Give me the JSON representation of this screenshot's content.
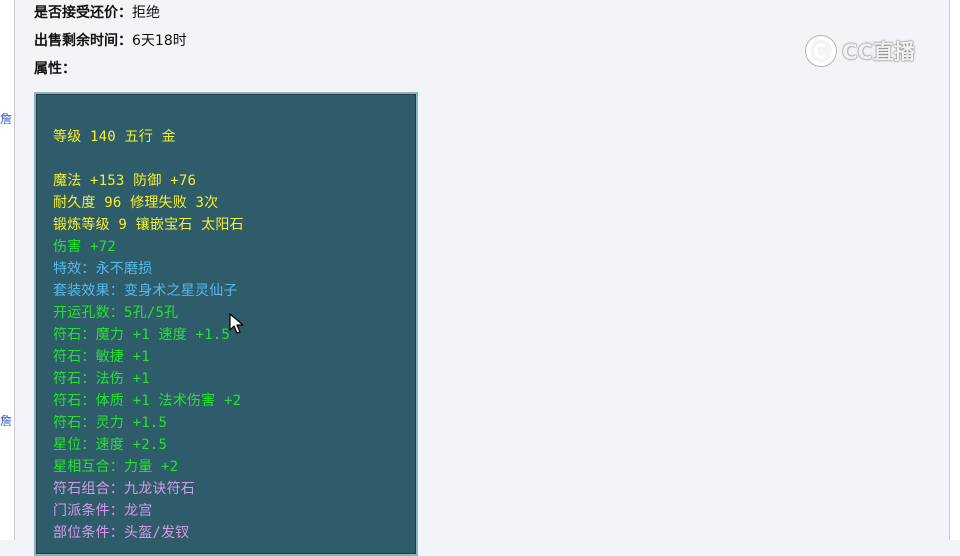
{
  "header": {
    "counter_offer_label": "是否接受还价：",
    "counter_offer_value": "拒绝",
    "time_left_label": "出售剩余时间：",
    "time_left_value": "6天18时",
    "attributes_label": "属性："
  },
  "edge_marks": [
    "詹",
    "詹"
  ],
  "item": {
    "lines": [
      {
        "text": "等级 140 五行 金",
        "color": "#f4f02a"
      },
      {
        "text": "",
        "color": "#f4f02a"
      },
      {
        "text": "魔法 +153 防御 +76",
        "color": "#f4f02a"
      },
      {
        "text": "耐久度 96 修理失败 3次",
        "color": "#f4f02a"
      },
      {
        "text": "锻炼等级 9 镶嵌宝石 太阳石",
        "color": "#f4f02a"
      },
      {
        "text": "伤害 +72",
        "color": "#22e52a"
      },
      {
        "text": "特效：永不磨损",
        "color": "#57b9e8"
      },
      {
        "text": "套装效果：变身术之星灵仙子",
        "color": "#57b9e8"
      },
      {
        "text": "开运孔数：5孔/5孔",
        "color": "#22e52a"
      },
      {
        "text": "符石：魔力 +1 速度 +1.5",
        "color": "#22e52a"
      },
      {
        "text": "符石：敏捷 +1",
        "color": "#22e52a"
      },
      {
        "text": "符石：法伤 +1",
        "color": "#22e52a"
      },
      {
        "text": "符石：体质 +1 法术伤害 +2",
        "color": "#22e52a"
      },
      {
        "text": "符石：灵力 +1.5",
        "color": "#22e52a"
      },
      {
        "text": "星位：速度 +2.5",
        "color": "#22e52a"
      },
      {
        "text": "星相互合：力量 +2",
        "color": "#22e52a"
      },
      {
        "text": "符石组合：九龙诀符石",
        "color": "#d49ae8"
      },
      {
        "text": "门派条件：龙宫",
        "color": "#d49ae8"
      },
      {
        "text": "部位条件：头盔/发钗",
        "color": "#d49ae8"
      }
    ]
  },
  "watermark": {
    "text": "CC直播",
    "icon": "cc-logo-icon"
  },
  "cursor": {
    "icon": "mouse-pointer-icon"
  }
}
